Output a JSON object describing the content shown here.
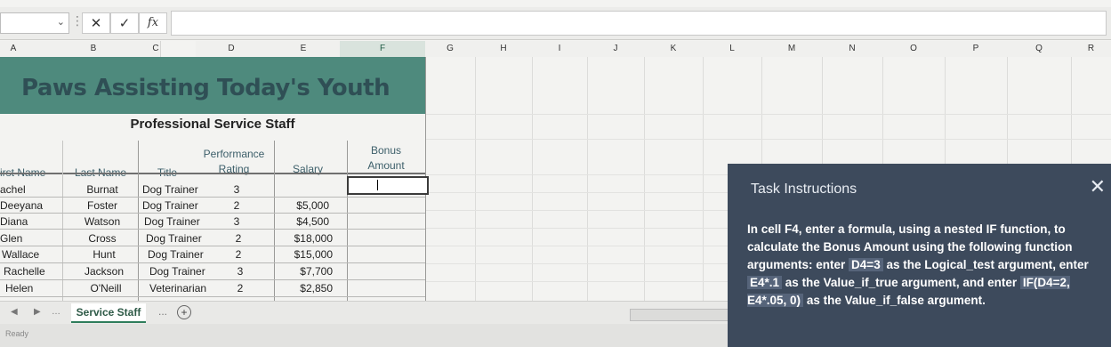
{
  "formula_bar": {
    "x_symbol": "✕",
    "check_symbol": "✓",
    "fx_symbol": "fx",
    "value": ""
  },
  "columns": [
    "A",
    "B",
    "C",
    "D",
    "E",
    "F",
    "G",
    "H",
    "I",
    "J",
    "K",
    "L",
    "M",
    "N",
    "O",
    "P",
    "Q",
    "R"
  ],
  "selected_column": "F",
  "banner": {
    "title": "Paws Assisting Today's Youth",
    "color": "#4e8a7d"
  },
  "subtitle": "Professional Service Staff",
  "headers": {
    "first_name": "irst Name",
    "last_name": "Last Name",
    "title": "Title",
    "rating_l1": "Performance",
    "rating_l2": "Rating",
    "salary": "Salary",
    "bonus_l1": "Bonus",
    "bonus_l2": "Amount"
  },
  "rows": [
    {
      "first": "achel",
      "last": "Burnat",
      "title": "Dog Trainer",
      "rating": "3",
      "salary": ""
    },
    {
      "first": "Deeyana",
      "last": "Foster",
      "title": "Dog Trainer",
      "rating": "2",
      "salary": "$5,000"
    },
    {
      "first": "Diana",
      "last": "Watson",
      "title": "Dog Trainer",
      "rating": "3",
      "salary": "$4,500"
    },
    {
      "first": "Glen",
      "last": "Cross",
      "title": "Dog Trainer",
      "rating": "2",
      "salary": "$18,000"
    },
    {
      "first": "Wallace",
      "last": "Hunt",
      "title": "Dog Trainer",
      "rating": "2",
      "salary": "$15,000"
    },
    {
      "first": "Rachelle",
      "last": "Jackson",
      "title": "Dog Trainer",
      "rating": "3",
      "salary": "$7,700"
    },
    {
      "first": "Helen",
      "last": "O'Neill",
      "title": "Veterinarian",
      "rating": "2",
      "salary": "$2,850"
    }
  ],
  "sheet_tabs": {
    "active": "Service Staff",
    "more": "...",
    "add": "+"
  },
  "status": {
    "text": "Ready"
  },
  "task_pane": {
    "title": "Task Instructions",
    "close": "✕",
    "p1": "In cell F4, enter a formula, using a nested IF function, to calculate the Bonus Amount using the following function arguments: enter",
    "code1": "D4=3",
    "p2": "as the Logical_test argument, enter",
    "code2": "E4*.1",
    "p3": "as the Value_if_true argument, and enter",
    "code3": "IF(D4=2, E4*.05, 0)",
    "p4": "as the Value_if_false argument."
  }
}
